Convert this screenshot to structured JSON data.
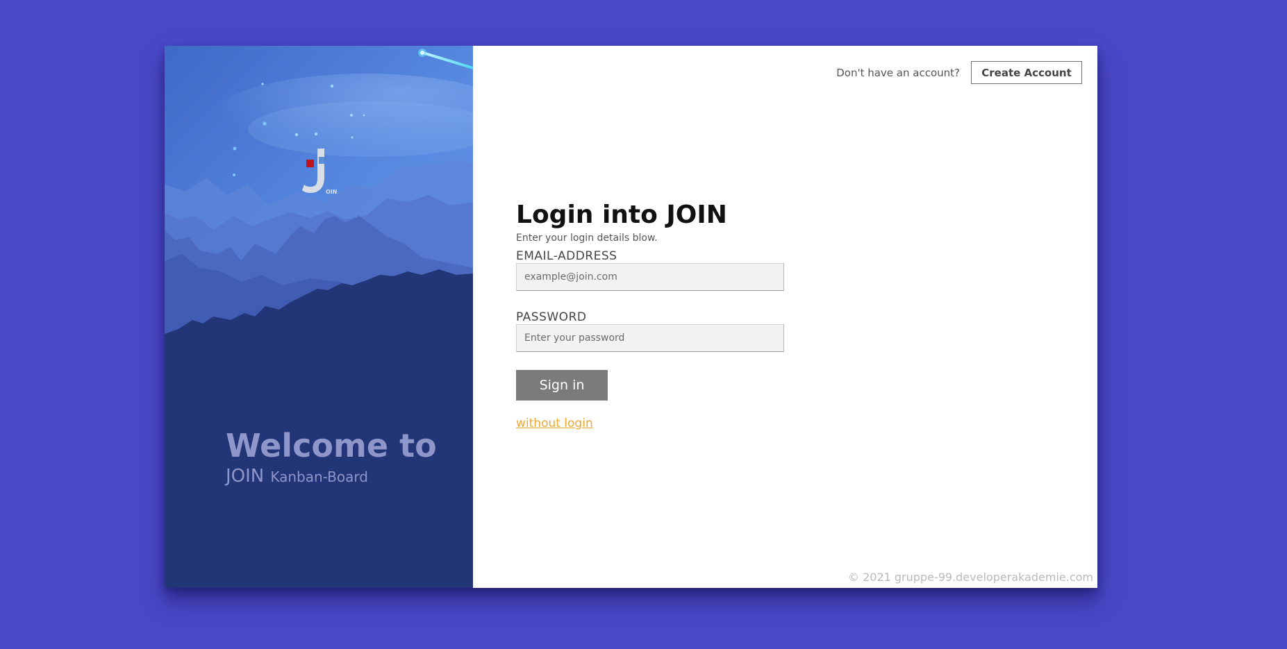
{
  "hero": {
    "logo_letter": "J",
    "logo_suffix": "OIN",
    "welcome_title": "Welcome to",
    "welcome_brand": "JOIN",
    "welcome_tagline": "Kanban-Board"
  },
  "header": {
    "no_account_text": "Don't have an account?",
    "create_account_label": "Create Account"
  },
  "login": {
    "title": "Login into JOIN",
    "subtitle": "Enter your login details blow.",
    "email_label": "EMAIL-ADDRESS",
    "email_placeholder": "example@join.com",
    "email_value": "",
    "password_label": "PASSWORD",
    "password_placeholder": "Enter your password",
    "password_value": "",
    "signin_label": "Sign in",
    "guest_link": "without login"
  },
  "footer": {
    "copyright": "© 2021 gruppe-99.developerakademie.com"
  },
  "colors": {
    "page_background": "#4a48c6",
    "hero_sky": "#4f7fd8",
    "hero_mountains_dark": "#223577",
    "signin_button": "#7b7b7b",
    "link": "#f0a62f",
    "logo_red": "#c0141c",
    "logo_blue": "#5b8fd8"
  }
}
